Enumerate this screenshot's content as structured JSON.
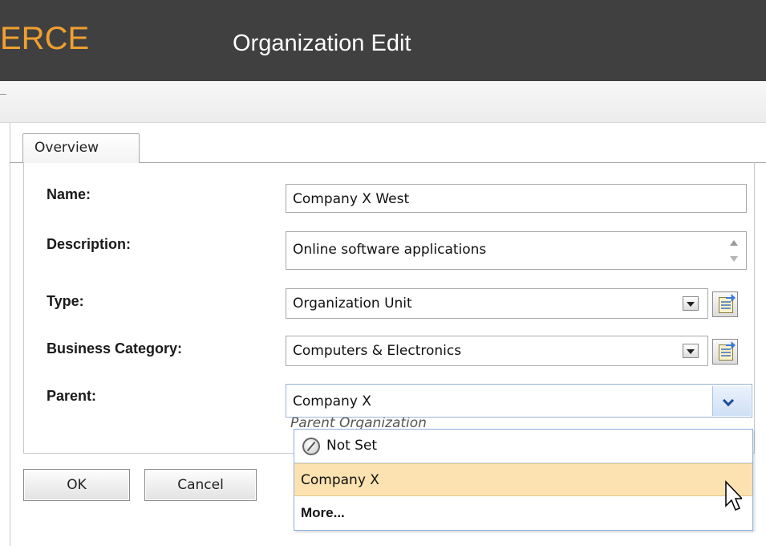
{
  "header": {
    "brand": "ERCE",
    "title": "Organization Edit"
  },
  "tabs": [
    {
      "label": "Overview",
      "selected": true
    }
  ],
  "form": {
    "name": {
      "label": "Name:",
      "value": "Company X West"
    },
    "description": {
      "label": "Description:",
      "value": "Online software applications"
    },
    "type": {
      "label": "Type:",
      "value": "Organization Unit"
    },
    "business_category": {
      "label": "Business Category:",
      "value": "Computers & Electronics"
    },
    "parent": {
      "label": "Parent:",
      "value": "Company X",
      "hidden_subtext": "Parent Organization"
    }
  },
  "dropdown": {
    "items": [
      {
        "label": "Not Set",
        "icon": "not-set-icon"
      },
      {
        "label": "Company X",
        "highlighted": true
      },
      {
        "label": "More..."
      }
    ]
  },
  "buttons": {
    "ok": "OK",
    "cancel": "Cancel"
  },
  "colors": {
    "header_bg": "#404040",
    "brand": "#f0a030",
    "highlight": "#fbe2b0",
    "dropdown_border": "#8fb2dd"
  }
}
